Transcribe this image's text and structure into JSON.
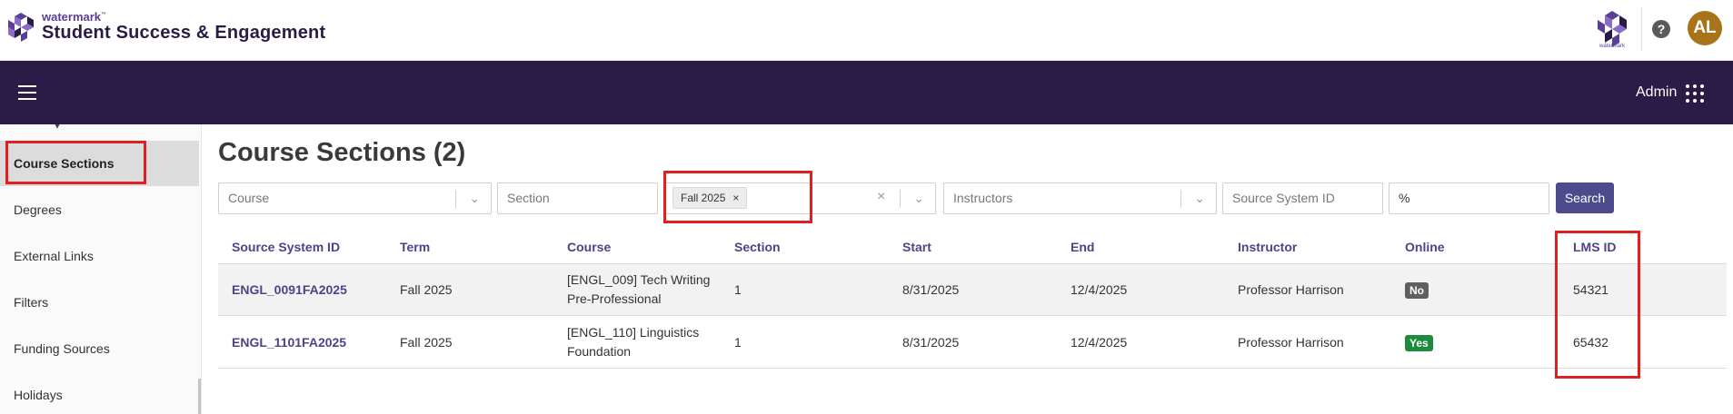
{
  "header": {
    "brand_small": "watermark",
    "brand_tm": "™",
    "app_title": "Student Success & Engagement",
    "right_logo_caption": "watermark",
    "help_icon_glyph": "?",
    "avatar_initials": "AL",
    "avatar_color": "#a8741a"
  },
  "navbar": {
    "role_label": "Admin",
    "bg_color": "#2b1b47"
  },
  "sidebar": {
    "items": [
      {
        "label": "Course Sections",
        "active": true
      },
      {
        "label": "Degrees",
        "active": false
      },
      {
        "label": "External Links",
        "active": false
      },
      {
        "label": "Filters",
        "active": false
      },
      {
        "label": "Funding Sources",
        "active": false
      },
      {
        "label": "Holidays",
        "active": false
      }
    ]
  },
  "main": {
    "title": "Course Sections (2)",
    "filters": {
      "course_placeholder": "Course",
      "section_placeholder": "Section",
      "term_chip": "Fall 2025",
      "instructors_placeholder": "Instructors",
      "source_system_id_placeholder": "Source System ID",
      "lms_value": "%",
      "search_label": "Search"
    },
    "table": {
      "columns": [
        "Source System ID",
        "Term",
        "Course",
        "Section",
        "Start",
        "End",
        "Instructor",
        "Online",
        "LMS ID"
      ],
      "rows": [
        {
          "source_system_id": "ENGL_0091FA2025",
          "term": "Fall 2025",
          "course_line1": "[ENGL_009] Tech Writing",
          "course_line2": "Pre-Professional",
          "section": "1",
          "start": "8/31/2025",
          "end": "12/4/2025",
          "instructor": "Professor Harrison",
          "online": "No",
          "lms_id": "54321"
        },
        {
          "source_system_id": "ENGL_1101FA2025",
          "term": "Fall 2025",
          "course_line1": "[ENGL_110] Linguistics",
          "course_line2": "Foundation",
          "section": "1",
          "start": "8/31/2025",
          "end": "12/4/2025",
          "instructor": "Professor Harrison",
          "online": "Yes",
          "lms_id": "65432"
        }
      ]
    }
  },
  "annotation_color": "#e02020"
}
